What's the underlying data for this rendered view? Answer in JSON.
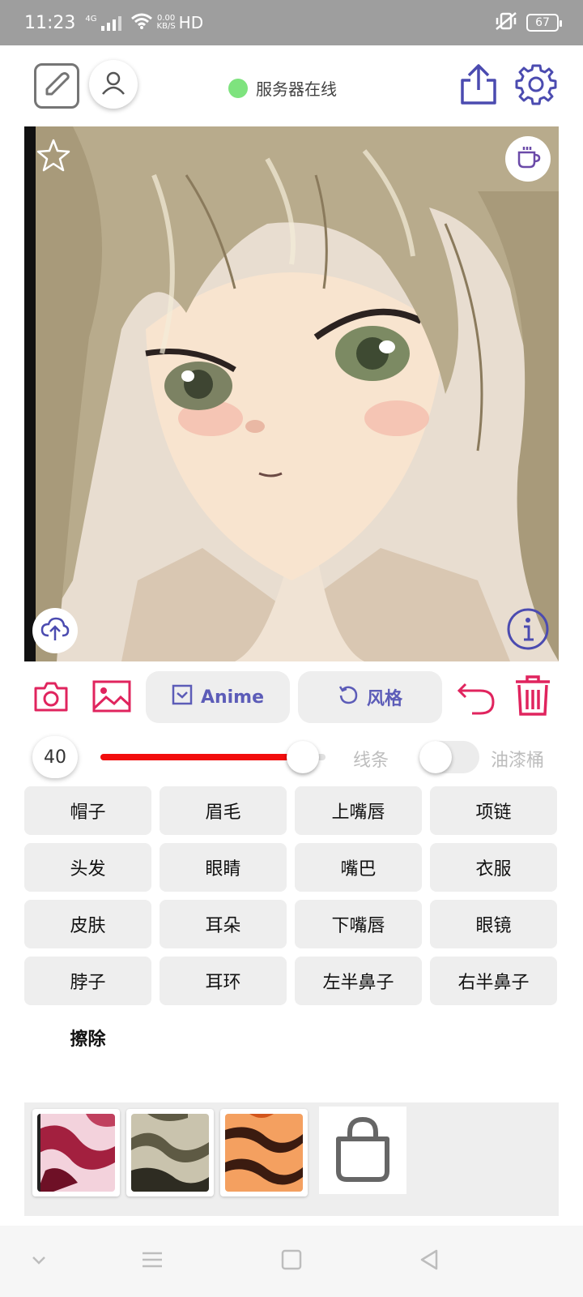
{
  "status_bar": {
    "time": "11:23",
    "network": "4G",
    "speed_value": "0.00",
    "speed_unit": "KB/S",
    "hd": "HD",
    "battery": "67"
  },
  "header": {
    "server_status": "服务器在线",
    "server_status_color": "#7ee37e",
    "accent_color": "#5c5cb8"
  },
  "toolbar": {
    "anime_label": "Anime",
    "style_label": "风格",
    "danger_color": "#e0245e"
  },
  "brush": {
    "size": "40",
    "size_fraction": 0.9,
    "line_label": "线条",
    "bucket_label": "油漆桶",
    "bucket_enabled": false,
    "track_color": "#f20d0d"
  },
  "parts": [
    "帽子",
    "眉毛",
    "上嘴唇",
    "项链",
    "头发",
    "眼睛",
    "嘴巴",
    "衣服",
    "皮肤",
    "耳朵",
    "下嘴唇",
    "眼镜",
    "脖子",
    "耳环",
    "左半鼻子",
    "右半鼻子"
  ],
  "erase_label": "擦除",
  "textures": [
    {
      "name": "crimson-marble",
      "colors": [
        "#f3d2dc",
        "#a3203f",
        "#6e1026"
      ]
    },
    {
      "name": "olive-stone",
      "colors": [
        "#c9c3ad",
        "#5e5a44",
        "#2e2c22"
      ]
    },
    {
      "name": "tiger-stripes",
      "colors": [
        "#f4a060",
        "#d2551c",
        "#3b1b10"
      ]
    }
  ]
}
